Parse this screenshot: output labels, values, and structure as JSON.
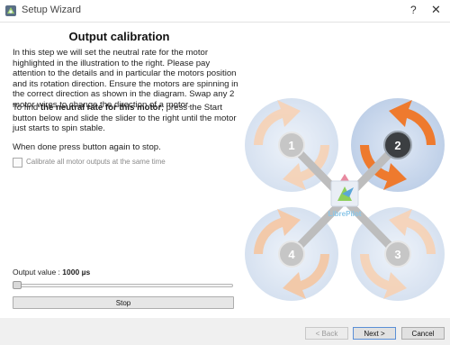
{
  "window": {
    "title": "Setup Wizard",
    "help_glyph": "?",
    "close_glyph": "✕",
    "app_icon": "librepilot-logo-icon"
  },
  "page": {
    "title": "Output calibration",
    "paragraph1": "In this step we will set the neutral rate for the motor highlighted in the illustration to the right. Please pay attention to the details and in particular the motors position and its rotation direction. Ensure the motors are spinning in the correct direction as shown in the diagram. Swap any 2 motor wires to change the direction of a motor.",
    "paragraph2_prefix": "To find ",
    "paragraph2_bold": "the neutral rate for this motor",
    "paragraph2_suffix": ", press the Start button below and slide the slider to the right until the motor just starts to spin stable.",
    "paragraph3": "When done press button again to stop.",
    "checkbox_label": "Calibrate all motor outputs at the same time",
    "checkbox_checked": false,
    "checkbox_enabled": false
  },
  "output": {
    "label_prefix": "Output value : ",
    "value_text": "1000 µs",
    "slider_fraction": 0.0,
    "stop_label": "Stop"
  },
  "diagram": {
    "logo_text": "LibrePilot",
    "highlighted_motor": "2",
    "motors": [
      {
        "label": "1",
        "active": false
      },
      {
        "label": "2",
        "active": true
      },
      {
        "label": "3",
        "active": false
      },
      {
        "label": "4",
        "active": false
      }
    ],
    "colors": {
      "arm": "#bcbcbc",
      "prop_disc": "#d9e4f3",
      "arrow_light": "#f4c9a8",
      "arrow_active": "#ee7a2e",
      "motor_idle": "#c3c3c3",
      "motor_active": "#3c3f42",
      "accent": "#ee7a2e"
    }
  },
  "footer": {
    "back_label": "< Back",
    "next_label": "Next >",
    "cancel_label": "Cancel",
    "back_enabled": false
  }
}
